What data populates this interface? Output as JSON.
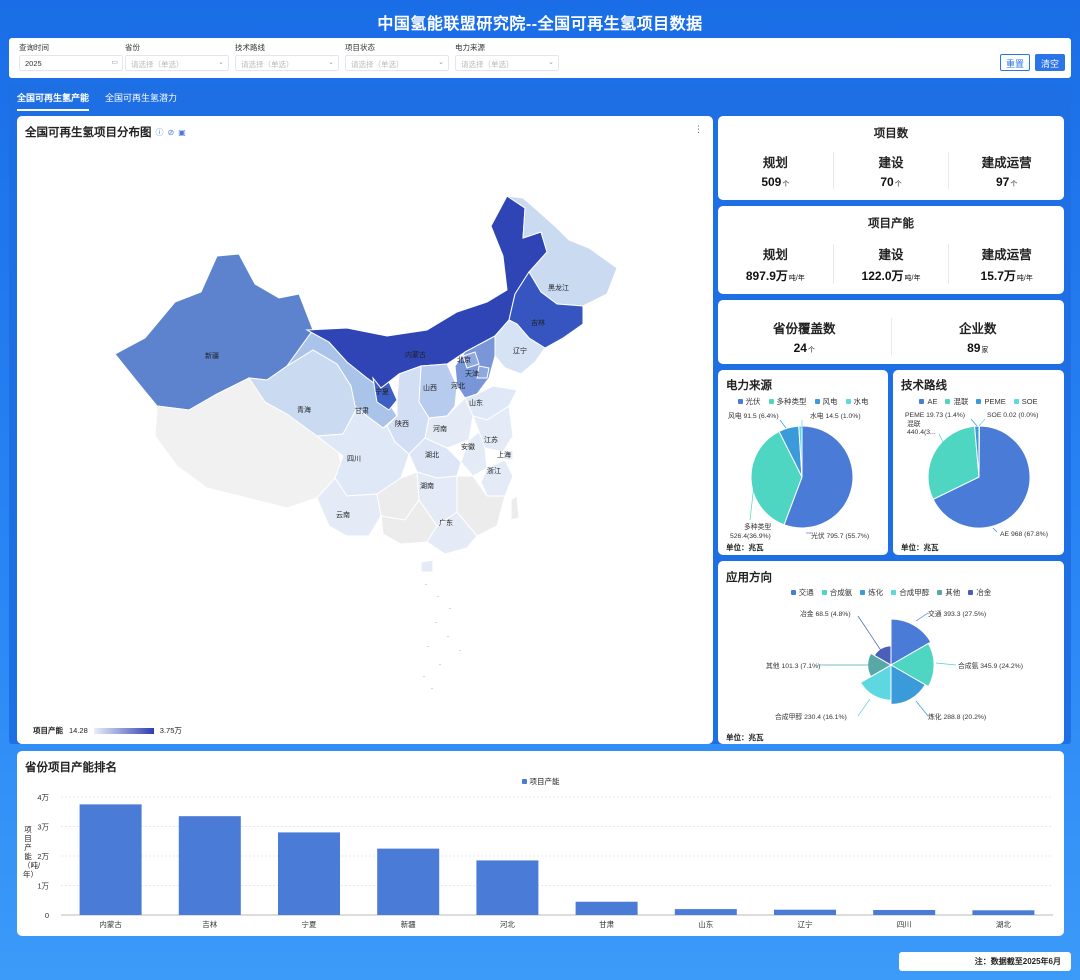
{
  "page_title": "中国氢能联盟研究院--全国可再生氢项目数据",
  "filters": [
    {
      "label": "查询时间",
      "value": "2025",
      "icon": "calendar-icon"
    },
    {
      "label": "省份",
      "placeholder": "请选择（单选）"
    },
    {
      "label": "技术路线",
      "placeholder": "请选择（单选）"
    },
    {
      "label": "项目状态",
      "placeholder": "请选择（单选）"
    },
    {
      "label": "电力来源",
      "placeholder": "请选择（单选）"
    }
  ],
  "buttons": {
    "reset": "重置",
    "clear": "清空"
  },
  "tabs": [
    "全国可再生氢产能",
    "全国可再生氢潜力"
  ],
  "map": {
    "title": "全国可再生氢项目分布图",
    "legend_label": "项目产能",
    "legend_min": "14.28",
    "legend_max": "3.75万",
    "provinces": [
      "黑龙江",
      "吉林",
      "辽宁",
      "内蒙古",
      "北京",
      "天津",
      "河北",
      "山西",
      "山东",
      "新疆",
      "青海",
      "甘肃",
      "宁夏",
      "陕西",
      "河南",
      "安徽",
      "江苏",
      "上海",
      "湖北",
      "浙江",
      "四川",
      "湖南",
      "云南",
      "广东"
    ]
  },
  "project_count": {
    "title": "项目数",
    "items": [
      {
        "label": "规划",
        "value": "509",
        "suffix": "个"
      },
      {
        "label": "建设",
        "value": "70",
        "suffix": "个"
      },
      {
        "label": "建成运营",
        "value": "97",
        "suffix": "个"
      }
    ]
  },
  "project_capacity": {
    "title": "项目产能",
    "items": [
      {
        "label": "规划",
        "value": "897.9万",
        "suffix": "吨/年"
      },
      {
        "label": "建设",
        "value": "122.0万",
        "suffix": "吨/年"
      },
      {
        "label": "建成运营",
        "value": "15.7万",
        "suffix": "吨/年"
      }
    ]
  },
  "coverage": {
    "items": [
      {
        "label": "省份覆盖数",
        "value": "24",
        "suffix": "个"
      },
      {
        "label": "企业数",
        "value": "89",
        "suffix": "家"
      }
    ]
  },
  "colors": {
    "blue": "#4a7bd6",
    "teal": "#4fd6c3",
    "mid": "#3b9ad9",
    "cyan": "#5ed8e0",
    "grey_teal": "#59a8a8",
    "navy": "#4a5fb8"
  },
  "power_source": {
    "title": "电力来源",
    "unit": "单位：兆瓦",
    "legend": [
      "光伏",
      "多种类型",
      "风电",
      "水电"
    ],
    "labels": [
      "光伏 795.7 (55.7%)",
      "多种类型",
      "526.4(36.9%)",
      "风电 91.5 (6.4%)",
      "水电 14.5 (1.0%)"
    ]
  },
  "tech_route": {
    "title": "技术路线",
    "unit": "单位：兆瓦",
    "legend": [
      "AE",
      "混联",
      "PEME",
      "SOE"
    ],
    "labels": [
      "AE 968 (67.8%)",
      "混联",
      "440.4(3...",
      "PEME 19.73 (1.4%)",
      "SOE 0.02 (0.0%)"
    ]
  },
  "application": {
    "title": "应用方向",
    "unit": "单位：兆瓦",
    "legend": [
      "交通",
      "合成氨",
      "炼化",
      "合成甲醇",
      "其他",
      "冶金"
    ],
    "labels": [
      "交通 393.3 (27.5%)",
      "合成氨 345.9 (24.2%)",
      "炼化 288.8 (20.2%)",
      "合成甲醇 230.4 (16.1%)",
      "其他 101.3 (7.1%)",
      "冶金 68.5 (4.8%)"
    ]
  },
  "ranking": {
    "title": "省份项目产能排名",
    "legend": "项目产能",
    "ylabel": "项目产能（吨/年）",
    "yticks": [
      "0",
      "1万",
      "2万",
      "3万",
      "4万"
    ]
  },
  "footnote": "注：数据截至2025年6月",
  "chart_data": [
    {
      "type": "pie",
      "title": "电力来源",
      "unit": "兆瓦",
      "categories": [
        "光伏",
        "多种类型",
        "风电",
        "水电"
      ],
      "values": [
        795.7,
        526.4,
        91.5,
        14.5
      ],
      "percent": [
        55.7,
        36.9,
        6.4,
        1.0
      ]
    },
    {
      "type": "pie",
      "title": "技术路线",
      "unit": "兆瓦",
      "categories": [
        "AE",
        "混联",
        "PEME",
        "SOE"
      ],
      "values": [
        968,
        440.4,
        19.73,
        0.02
      ],
      "percent": [
        67.8,
        30.8,
        1.4,
        0.0
      ]
    },
    {
      "type": "pie",
      "subtype": "rose",
      "title": "应用方向",
      "unit": "兆瓦",
      "categories": [
        "交通",
        "合成氨",
        "炼化",
        "合成甲醇",
        "其他",
        "冶金"
      ],
      "values": [
        393.3,
        345.9,
        288.8,
        230.4,
        101.3,
        68.5
      ],
      "percent": [
        27.5,
        24.2,
        20.2,
        16.1,
        7.1,
        4.8
      ]
    },
    {
      "type": "bar",
      "title": "省份项目产能排名",
      "ylabel": "项目产能（吨/年）",
      "categories": [
        "内蒙古",
        "吉林",
        "宁夏",
        "新疆",
        "河北",
        "甘肃",
        "山东",
        "辽宁",
        "四川",
        "湖北"
      ],
      "series": [
        {
          "name": "项目产能",
          "values": [
            37500,
            33500,
            28000,
            22500,
            18500,
            4500,
            2000,
            1800,
            1700,
            1600
          ]
        }
      ],
      "ylim": [
        0,
        40000
      ],
      "grid": true,
      "legend": "top-center"
    }
  ]
}
